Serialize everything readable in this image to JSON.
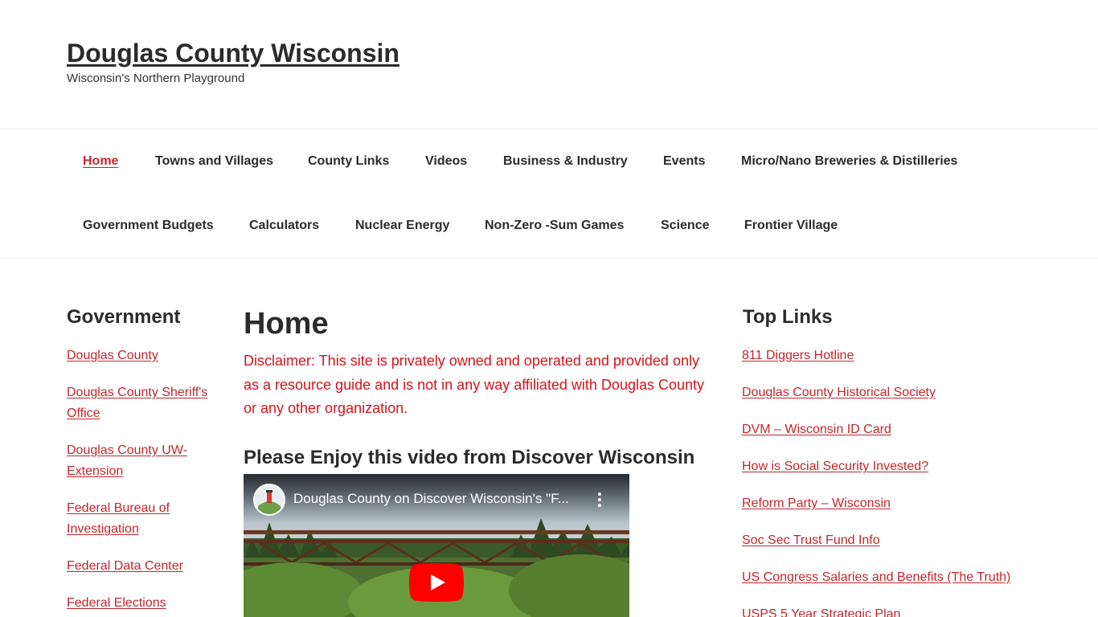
{
  "site": {
    "title": "Douglas County Wisconsin",
    "tagline": "Wisconsin's Northern Playground"
  },
  "nav": {
    "items": [
      {
        "label": "Home",
        "active": true
      },
      {
        "label": "Towns and Villages"
      },
      {
        "label": "County Links"
      },
      {
        "label": "Videos"
      },
      {
        "label": "Business & Industry"
      },
      {
        "label": "Events"
      },
      {
        "label": "Micro/Nano Breweries & Distilleries"
      },
      {
        "label": "Government Budgets"
      },
      {
        "label": "Calculators"
      },
      {
        "label": "Nuclear Energy"
      },
      {
        "label": "Non-Zero -Sum Games"
      },
      {
        "label": "Science"
      },
      {
        "label": "Frontier Village"
      }
    ]
  },
  "left_sidebar": {
    "title": "Government",
    "links": [
      {
        "line1": "Douglas County",
        "line2": ""
      },
      {
        "line1": "Douglas County Sheriff's",
        "line2": "Office"
      },
      {
        "line1": "Douglas County UW-",
        "line2": "Extension"
      },
      {
        "line1": "Federal Bureau of",
        "line2": "Investigation"
      },
      {
        "line1": "Federal Data Center",
        "line2": ""
      },
      {
        "line1": "Federal Elections",
        "line2": ""
      }
    ]
  },
  "main": {
    "title": "Home",
    "disclaimer": "Disclaimer: This site is privately owned and operated and provided only as a resource guide and is not in any way affiliated with Douglas County or any other organization.",
    "video_heading": "Please Enjoy this video from Discover Wisconsin",
    "video": {
      "title": "Douglas County on Discover Wisconsin's \"F...",
      "play_icon": "youtube-play-icon",
      "more_icon": "more-vertical-icon"
    }
  },
  "right_sidebar": {
    "title": "Top Links",
    "links": [
      "811 Diggers Hotline",
      "Douglas County Historical Society",
      "DVM – Wisconsin ID Card",
      "How is Social Security Invested?",
      "Reform Party – Wisconsin",
      "Soc Sec Trust Fund Info",
      "US Congress Salaries and Benefits (The Truth)",
      "USPS 5 Year Strategic Plan"
    ]
  },
  "colors": {
    "accent": "#c1272d",
    "disclaimer": "#d3141c",
    "text": "#2b2b2b",
    "youtube_red": "#ff0000"
  }
}
